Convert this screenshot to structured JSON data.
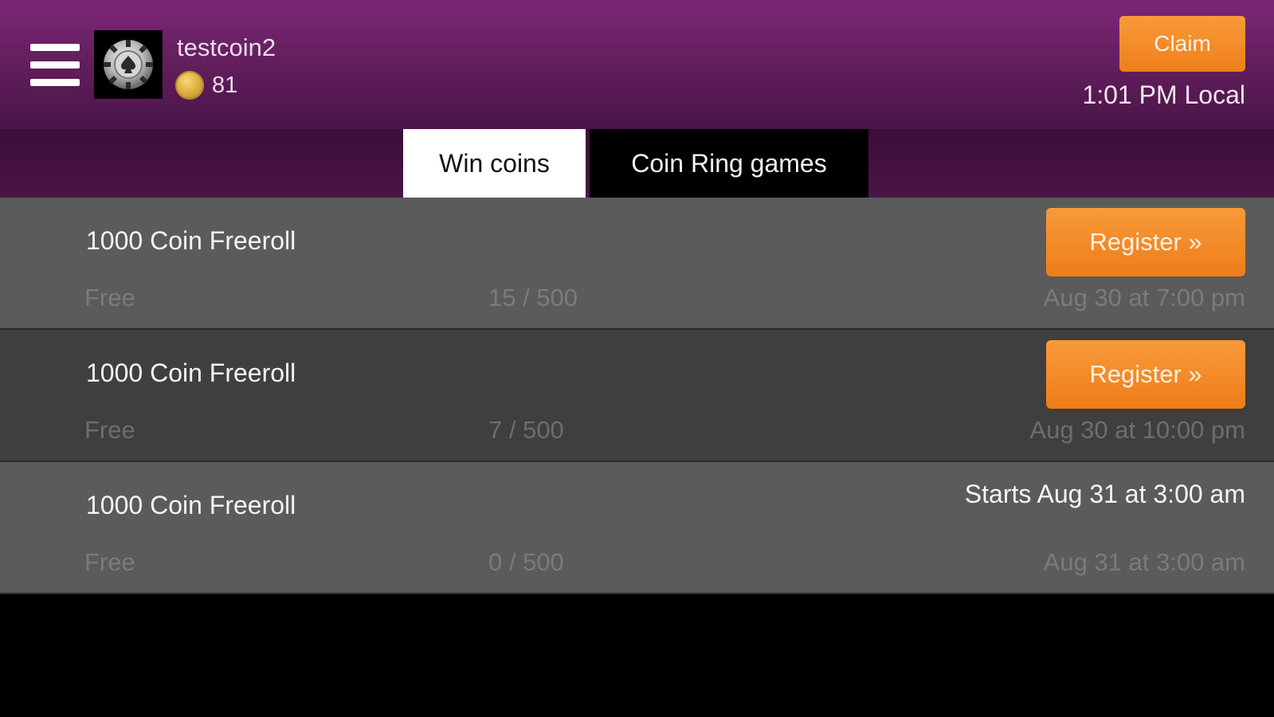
{
  "header": {
    "username": "testcoin2",
    "coins": "81",
    "claim_label": "Claim",
    "local_time": "1:01 PM Local",
    "icons": {
      "menu": "hamburger-menu-icon",
      "avatar": "poker-chip-avatar",
      "coin": "coin-icon"
    }
  },
  "tabs": [
    {
      "label": "Win coins",
      "active": true
    },
    {
      "label": "Coin Ring games",
      "active": false
    }
  ],
  "tournaments": [
    {
      "name": "1000 Coin Freeroll",
      "fee": "Free",
      "players": "15 / 500",
      "time": "Aug 30 at 7:00 pm",
      "action": "Register »"
    },
    {
      "name": "1000 Coin Freeroll",
      "fee": "Free",
      "players": "7 / 500",
      "time": "Aug 30 at 10:00 pm",
      "action": "Register »"
    },
    {
      "name": "1000 Coin Freeroll",
      "fee": "Free",
      "players": "0 / 500",
      "time": "Aug 31 at 3:00 am",
      "status": "Starts Aug 31 at 3:00 am"
    }
  ],
  "colors": {
    "header": "#7c2775",
    "accent": "#f28a2a",
    "row_light": "#5b5b5b",
    "row_dark": "#3f3f3f"
  }
}
